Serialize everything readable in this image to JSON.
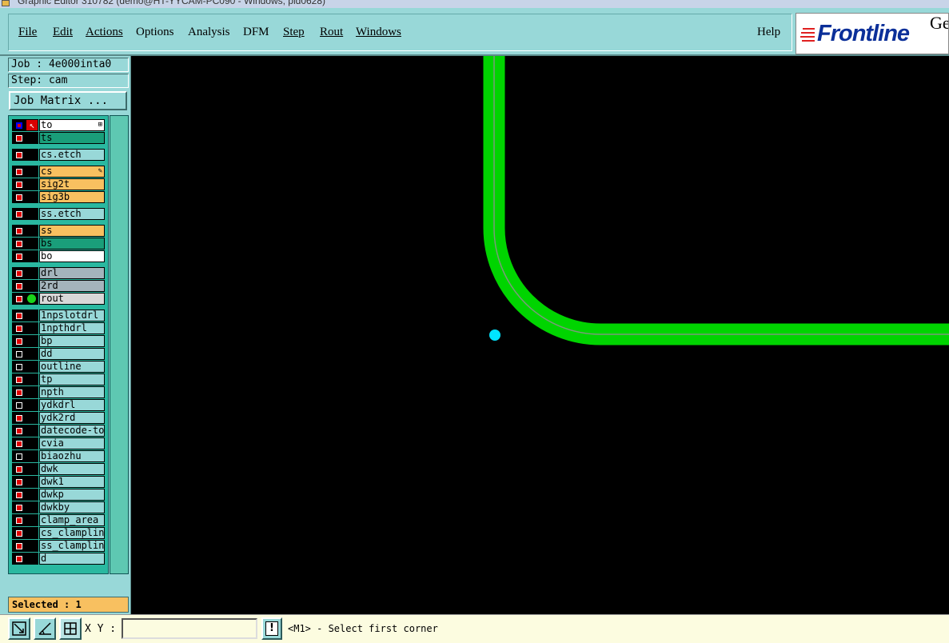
{
  "window": {
    "title": "Graphic Editor 310782 (demo@HT-YYCAM-PC090 - Windows, pid0628)"
  },
  "menubar": {
    "items": [
      {
        "id": "file",
        "label": "File"
      },
      {
        "id": "edit",
        "label": "Edit"
      },
      {
        "id": "actions",
        "label": "Actions"
      },
      {
        "id": "options",
        "label": "Options"
      },
      {
        "id": "analysis",
        "label": "Analysis"
      },
      {
        "id": "dfm",
        "label": "DFM"
      },
      {
        "id": "step",
        "label": "Step"
      },
      {
        "id": "rout",
        "label": "Rout"
      },
      {
        "id": "windows",
        "label": "Windows"
      }
    ],
    "help_label": "Help"
  },
  "logo": {
    "brand_text": "Frontline",
    "suffix_text": "Ge",
    "brand_color": "#0b2f99",
    "stripe_color": "#e02020"
  },
  "left_panel": {
    "job": "Job : 4e000inta0",
    "step": "Step: cam",
    "job_matrix_label": "Job Matrix ...",
    "selected": "Selected : 1",
    "layers": [
      {
        "name": "to",
        "color": "white",
        "state": "affected",
        "marker": "cursor",
        "edit_mark": "⊞"
      },
      {
        "name": "ts",
        "color": "teal",
        "state": "on"
      },
      {
        "name": "cs.etch",
        "color": "lteal",
        "state": "on"
      },
      {
        "name": "cs",
        "color": "orange",
        "state": "on",
        "edit_mark": "✎"
      },
      {
        "name": "sig2t",
        "color": "orange",
        "state": "on"
      },
      {
        "name": "sig3b",
        "color": "orange",
        "state": "on"
      },
      {
        "name": "ss.etch",
        "color": "lteal",
        "state": "on"
      },
      {
        "name": "ss",
        "color": "orange",
        "state": "on"
      },
      {
        "name": "bs",
        "color": "teal",
        "state": "on"
      },
      {
        "name": "bo",
        "color": "white",
        "state": "on"
      },
      {
        "name": "drl",
        "color": "gray",
        "state": "on"
      },
      {
        "name": "2rd",
        "color": "gray",
        "state": "on"
      },
      {
        "name": "rout",
        "color": "lgray",
        "state": "on",
        "marker": "display-dot"
      },
      {
        "name": "1npslotdrl",
        "color": "lteal",
        "state": "on"
      },
      {
        "name": "1npthdrl",
        "color": "lteal",
        "state": "on"
      },
      {
        "name": "bp",
        "color": "lteal",
        "state": "on"
      },
      {
        "name": "dd",
        "color": "lteal",
        "state": "off"
      },
      {
        "name": "outline",
        "color": "lteal",
        "state": "off"
      },
      {
        "name": "tp",
        "color": "lteal",
        "state": "on"
      },
      {
        "name": "npth",
        "color": "lteal",
        "state": "on"
      },
      {
        "name": "ydkdrl",
        "color": "lteal",
        "state": "off"
      },
      {
        "name": "ydk2rd",
        "color": "lteal",
        "state": "on"
      },
      {
        "name": "datecode-to",
        "color": "lteal",
        "state": "on"
      },
      {
        "name": "cvia",
        "color": "lteal",
        "state": "on"
      },
      {
        "name": "biaozhu",
        "color": "lteal",
        "state": "off"
      },
      {
        "name": "dwk",
        "color": "lteal",
        "state": "on"
      },
      {
        "name": "dwk1",
        "color": "lteal",
        "state": "on"
      },
      {
        "name": "dwkp",
        "color": "lteal",
        "state": "on"
      },
      {
        "name": "dwkby",
        "color": "lteal",
        "state": "on"
      },
      {
        "name": "clamp_area",
        "color": "lteal",
        "state": "on"
      },
      {
        "name": "cs_clampline",
        "color": "lteal",
        "state": "on"
      },
      {
        "name": "ss_clampline",
        "color": "lteal",
        "state": "on"
      },
      {
        "name": "d",
        "color": "lteal",
        "state": "on"
      }
    ]
  },
  "canvas": {
    "background": "#000000",
    "rout_color": "#00d400",
    "centerline_color": "#7a9a7a",
    "point_color": "#00e5ff"
  },
  "statusbar": {
    "tool_icons": [
      "zoom-box-icon",
      "measure-icon",
      "snap-grid-icon"
    ],
    "xy_label": "X Y :",
    "xy_value": "",
    "prompt": "<M1> - Select first corner"
  }
}
